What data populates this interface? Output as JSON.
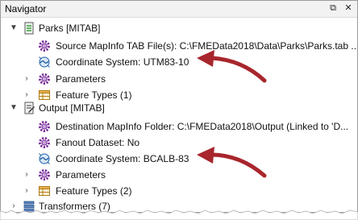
{
  "window": {
    "title": "Navigator",
    "pin_glyph": "⧉",
    "close_glyph": "✕"
  },
  "tree": {
    "parks": {
      "label": "Parks [MITAB]",
      "source": "Source MapInfo TAB File(s): C:\\FMEData2018\\Data\\Parks\\Parks.tab ...",
      "coord": "Coordinate System: UTM83-10",
      "params": "Parameters",
      "ftypes": "Feature Types (1)"
    },
    "output": {
      "label": "Output [MITAB]",
      "dest": "Destination MapInfo Folder: C:\\FMEData2018\\Output (Linked to 'D...",
      "fanout": "Fanout Dataset: No",
      "coord": "Coordinate System: BCALB-83",
      "params": "Parameters",
      "ftypes": "Feature Types (2)"
    },
    "transformers": "Transformers (7)"
  },
  "icons": {
    "expanded": "chevron-down-icon",
    "collapsed": "chevron-right-icon",
    "reader": "reader-icon",
    "writer": "writer-icon",
    "gear": "gear-icon",
    "globe": "globe-icon",
    "feature_type": "feature-type-icon",
    "transformers": "transformers-icon"
  },
  "colors": {
    "annotation_arrow": "#a8262d",
    "gear": "#7a2f9a",
    "globe": "#1f5fa8",
    "reader_green": "#3c9a3c"
  }
}
